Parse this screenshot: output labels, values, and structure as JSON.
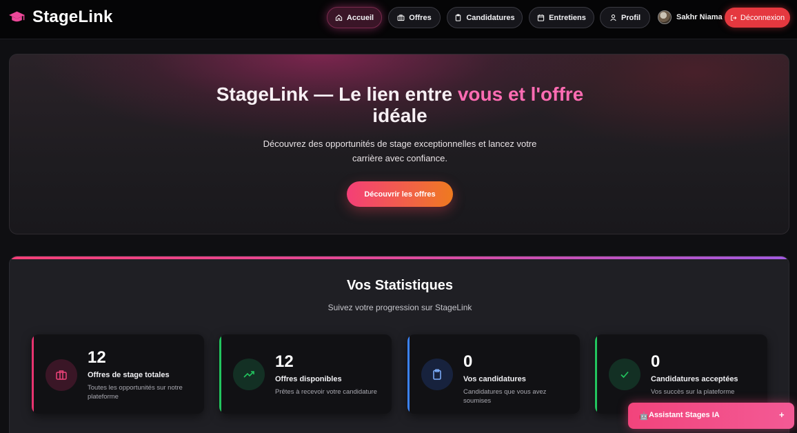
{
  "navbar": {
    "brand": "StageLink",
    "brand_icon": "graduation-cap-icon",
    "items": [
      {
        "label": "Accueil",
        "icon": "home-icon",
        "active": true
      },
      {
        "label": "Offres",
        "icon": "briefcase-icon",
        "active": false
      },
      {
        "label": "Candidatures",
        "icon": "clipboard-icon",
        "active": false
      },
      {
        "label": "Entretiens",
        "icon": "calendar-icon",
        "active": false
      },
      {
        "label": "Profil",
        "icon": "user-icon",
        "active": false
      }
    ],
    "user_name": "Sakhr Niama",
    "logout_label": "Déconnexion"
  },
  "hero": {
    "title_part1": "StageLink — Le lien entre ",
    "title_accent": "vous et l'offre",
    "title_part2": "idéale",
    "subtitle": "Découvrez des opportunités de stage exceptionnelles et lancez votre carrière avec confiance.",
    "cta_label": "Découvrir les offres"
  },
  "stats": {
    "title": "Vos Statistiques",
    "subtitle": "Suivez votre progression sur StageLink",
    "cards": [
      {
        "value": "12",
        "label": "Offres de stage totales",
        "desc": "Toutes les opportunités sur notre plateforme",
        "icon": "briefcase-icon",
        "accent": "#e8336f"
      },
      {
        "value": "12",
        "label": "Offres disponibles",
        "desc": "Prêtes à recevoir votre candidature",
        "icon": "trending-up-icon",
        "accent": "#22c55e"
      },
      {
        "value": "0",
        "label": "Vos candidatures",
        "desc": "Candidatures que vous avez soumises",
        "icon": "clipboard-icon",
        "accent": "#3b82f6"
      },
      {
        "value": "0",
        "label": "Candidatures acceptées",
        "desc": "Vos succès sur la plateforme",
        "icon": "check-icon",
        "accent": "#22c55e"
      }
    ]
  },
  "assistant": {
    "label": "Assistant Stages IA",
    "icon": "robot-icon",
    "toggle": "+"
  },
  "colors": {
    "accent_pink": "#f43f77",
    "accent_orange": "#ef7a1f",
    "logout_red": "#e5383f",
    "background": "#0f0f12"
  }
}
